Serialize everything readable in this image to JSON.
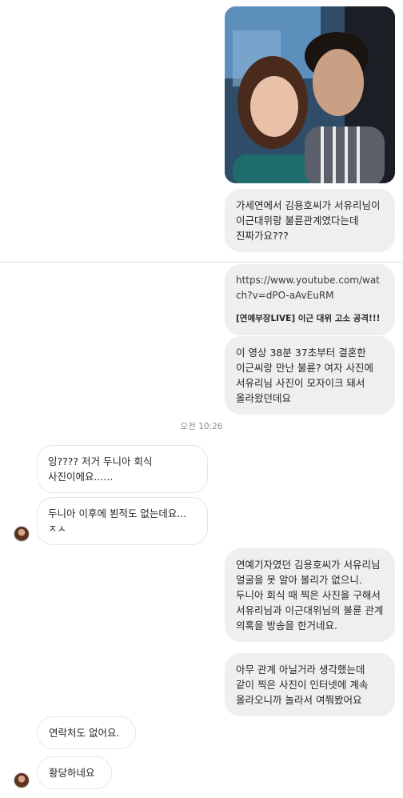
{
  "messages": {
    "m1": "가세연에서 김용호씨가 서유리님이 이근대위랑 불륜관계였다는데 진짜가요???",
    "link": {
      "url": "https://www.youtube.com/watch?v=dPO-aAvEuRM",
      "title": "[연예부장LIVE] 이근 대위 고소 공격!!!"
    },
    "m3": "이 영상 38분 37초부터 결혼한 이근씨랑 만난 불륜? 여자 사진에 서유리님 사진이 모자이크 돼서 올라왔던데요",
    "timestamp": "오전 10:26",
    "r1": "잉???? 저거 두니아 회식 사진이에요......",
    "r2": "두니아 이후에 뵌적도 없는데요...ㅈㅅ",
    "m4": "연예기자였던 김용호씨가 서유리님 얼굴을 못 알아 볼리가 없으니. 두니아 회식 때 찍은 사진을 구해서 서유리님과 이근대위님의 불륜 관계 의혹을 방송을 한거네요.",
    "m5": "아무 관계 아닐거라 생각했는데 같이 찍은 사진이 인터넷에 계속 올라오니까 놀라서 여쭤봤어요",
    "r3": "연락처도 없어요.",
    "r4": "황당하네요"
  },
  "colors": {
    "outgoing_bubble": "#efefef",
    "incoming_border": "#e6e6e6",
    "divider": "#dbdbdb"
  }
}
